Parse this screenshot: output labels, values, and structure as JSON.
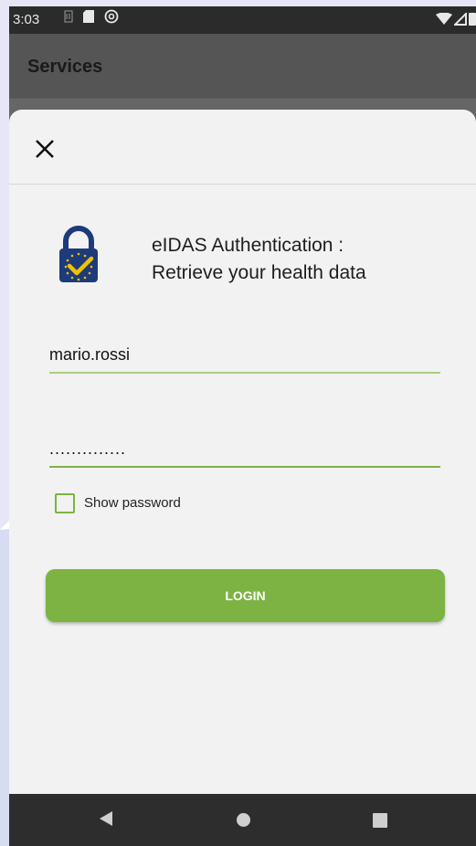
{
  "status_bar": {
    "time": "3:03",
    "left_icons": [
      "sim-card-icon",
      "sd-card-icon",
      "vpn-icon"
    ],
    "right_icons": [
      "wifi-icon",
      "signal-icon",
      "battery-icon"
    ]
  },
  "app_bar": {
    "title": "Services"
  },
  "dialog": {
    "close_icon": "close-icon",
    "logo_icon": "eidas-lock-icon",
    "title_line1": "eIDAS Authentication :",
    "title_line2": "Retrieve your health data",
    "username_value": "mario.rossi",
    "password_value": "..............",
    "show_password_label": "Show password",
    "show_password_checked": false,
    "login_label": "LOGIN"
  },
  "nav_bar": {
    "back_icon": "back-icon",
    "home_icon": "home-icon",
    "recents_icon": "recents-icon"
  },
  "colors": {
    "accent": "#7cb342",
    "underline_light": "#a9cf7e",
    "lock_blue": "#1d3b7a",
    "check_yellow": "#f2c200"
  }
}
